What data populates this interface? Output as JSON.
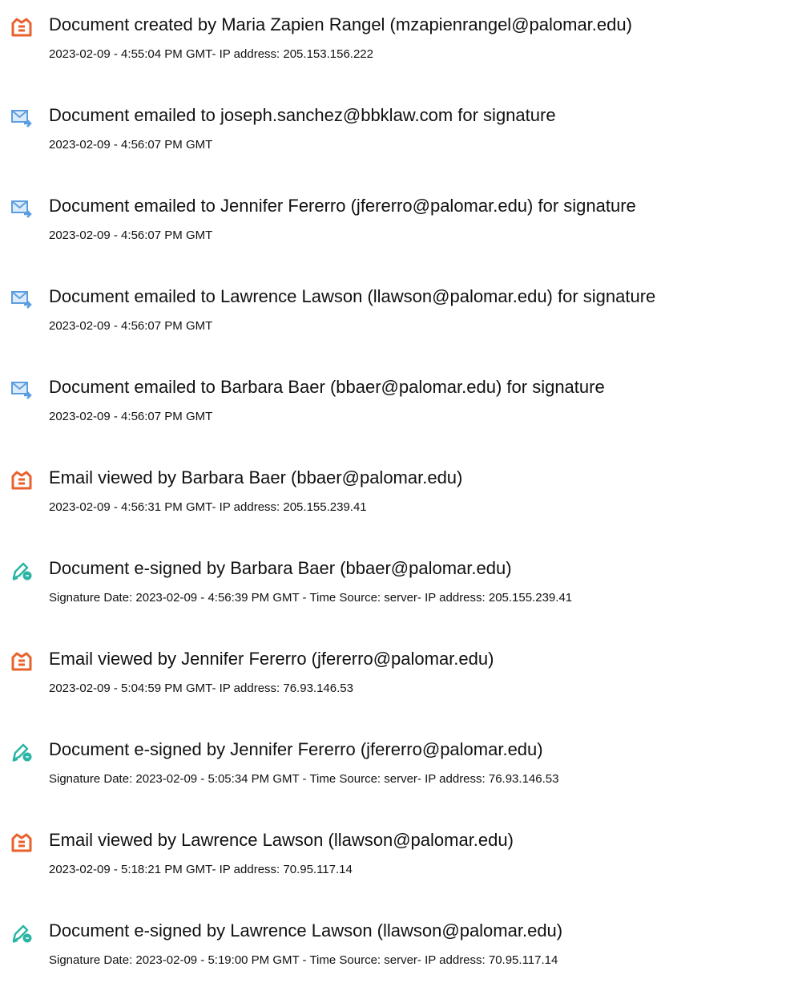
{
  "colors": {
    "created_icon": "#e8622d",
    "emailed_icon": "#5b9ee0",
    "signed_icon": "#2ab5a5"
  },
  "entries": [
    {
      "icon": "document-created-icon",
      "title": "Document created by Maria Zapien Rangel (mzapienrangel@palomar.edu)",
      "detail": "2023-02-09 - 4:55:04 PM GMT- IP address: 205.153.156.222"
    },
    {
      "icon": "email-sent-icon",
      "title": "Document emailed to joseph.sanchez@bbklaw.com for signature",
      "detail": "2023-02-09 - 4:56:07 PM GMT"
    },
    {
      "icon": "email-sent-icon",
      "title": "Document emailed to Jennifer Fererro (jfererro@palomar.edu) for signature",
      "detail": "2023-02-09 - 4:56:07 PM GMT"
    },
    {
      "icon": "email-sent-icon",
      "title": "Document emailed to Lawrence Lawson (llawson@palomar.edu) for signature",
      "detail": "2023-02-09 - 4:56:07 PM GMT"
    },
    {
      "icon": "email-sent-icon",
      "title": "Document emailed to Barbara Baer (bbaer@palomar.edu) for signature",
      "detail": "2023-02-09 - 4:56:07 PM GMT"
    },
    {
      "icon": "document-created-icon",
      "title": "Email viewed by Barbara Baer (bbaer@palomar.edu)",
      "detail": "2023-02-09 - 4:56:31 PM GMT- IP address: 205.155.239.41"
    },
    {
      "icon": "e-sign-pen-icon",
      "title": "Document e-signed by Barbara Baer (bbaer@palomar.edu)",
      "detail": "Signature Date: 2023-02-09 - 4:56:39 PM GMT - Time Source: server- IP address: 205.155.239.41"
    },
    {
      "icon": "document-created-icon",
      "title": "Email viewed by Jennifer Fererro (jfererro@palomar.edu)",
      "detail": "2023-02-09 - 5:04:59 PM GMT- IP address: 76.93.146.53"
    },
    {
      "icon": "e-sign-pen-icon",
      "title": "Document e-signed by Jennifer Fererro (jfererro@palomar.edu)",
      "detail": "Signature Date: 2023-02-09 - 5:05:34 PM GMT - Time Source: server- IP address: 76.93.146.53"
    },
    {
      "icon": "document-created-icon",
      "title": "Email viewed by Lawrence Lawson (llawson@palomar.edu)",
      "detail": "2023-02-09 - 5:18:21 PM GMT- IP address: 70.95.117.14"
    },
    {
      "icon": "e-sign-pen-icon",
      "title": "Document e-signed by Lawrence Lawson (llawson@palomar.edu)",
      "detail": "Signature Date: 2023-02-09 - 5:19:00 PM GMT - Time Source: server- IP address: 70.95.117.14"
    }
  ]
}
